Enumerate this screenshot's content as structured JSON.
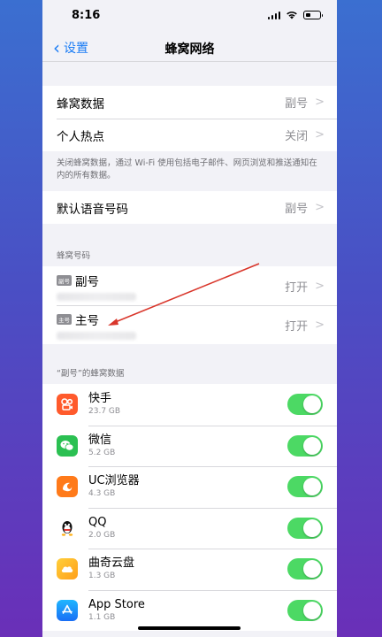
{
  "status_bar": {
    "time": "8:16"
  },
  "nav": {
    "back_label": "设置",
    "title": "蜂窝网络"
  },
  "group1": {
    "rows": [
      {
        "label": "蜂窝数据",
        "value": "副号"
      },
      {
        "label": "个人热点",
        "value": "关闭"
      }
    ],
    "footer": "关闭蜂窝数据，通过 Wi-Fi 使用包括电子邮件、网页浏览和推送通知在内的所有数据。"
  },
  "group2": {
    "rows": [
      {
        "label": "默认语音号码",
        "value": "副号"
      }
    ]
  },
  "sim_section": {
    "header": "蜂窝号码",
    "items": [
      {
        "badge": "副号",
        "name": "副号",
        "value": "打开"
      },
      {
        "badge": "主号",
        "name": "主号",
        "value": "打开"
      }
    ]
  },
  "apps_section": {
    "header": "“副号”的蜂窝数据",
    "apps": [
      {
        "name": "快手",
        "size": "23.7 GB",
        "icon": "kuaishou-icon",
        "color": "#ff5a2c",
        "enabled": true
      },
      {
        "name": "微信",
        "size": "5.2 GB",
        "icon": "wechat-icon",
        "color": "#2bc052",
        "enabled": true
      },
      {
        "name": "UC浏览器",
        "size": "4.3 GB",
        "icon": "uc-browser-icon",
        "color": "#ff7a1a",
        "enabled": true
      },
      {
        "name": "QQ",
        "size": "2.0 GB",
        "icon": "qq-icon",
        "color": "#ffffff",
        "enabled": true
      },
      {
        "name": "曲奇云盘",
        "size": "1.3 GB",
        "icon": "cloud-drive-icon",
        "color": "#ffb21a",
        "enabled": true
      },
      {
        "name": "App Store",
        "size": "1.1 GB",
        "icon": "app-store-icon",
        "color": "#1a8cff",
        "enabled": true
      }
    ]
  },
  "colors": {
    "accent": "#1a7cf5",
    "toggle_on": "#4cd964",
    "annotation_arrow": "#d9362b"
  }
}
